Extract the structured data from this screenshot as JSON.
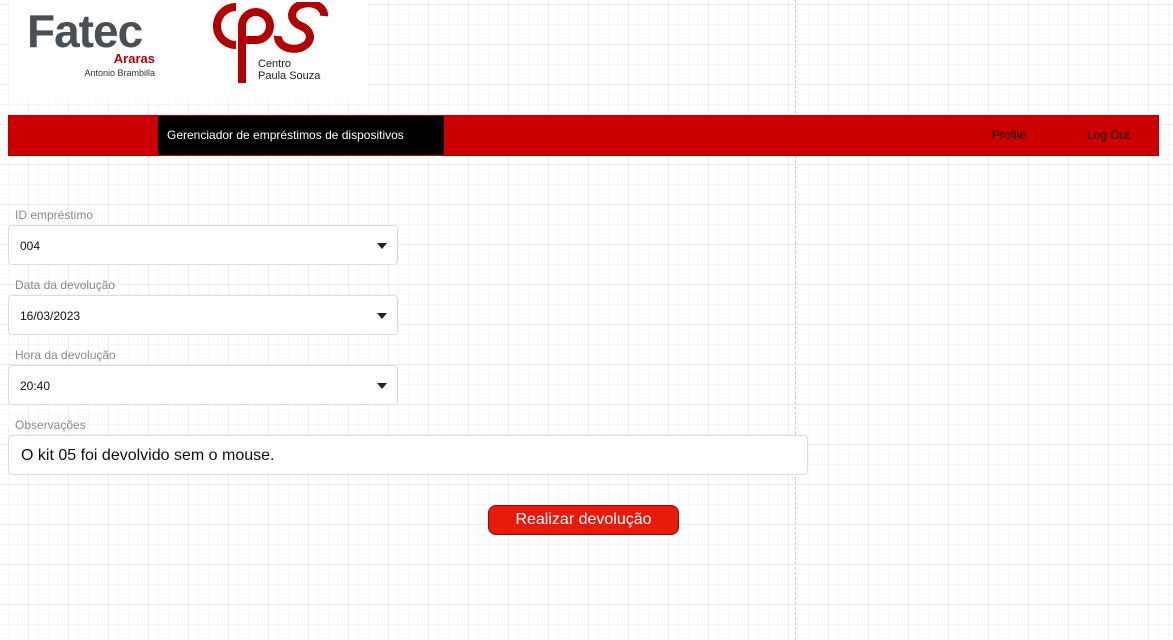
{
  "logos": {
    "fatec": {
      "name": "Fatec",
      "city": "Araras",
      "unit": "Antonio Brambilla"
    },
    "cps": {
      "line1": "Centro",
      "line2": "Paula Souza"
    }
  },
  "navbar": {
    "title": "Gerenciador de empréstimos de dispositivos",
    "profile_label": "Profile",
    "logout_label": "Log Out"
  },
  "form": {
    "loan_id": {
      "label": "ID empréstimo",
      "value": "004"
    },
    "return_date": {
      "label": "Data da devolução",
      "value": "16/03/2023"
    },
    "return_time": {
      "label": "Hora da devolução",
      "value": "20:40"
    },
    "notes": {
      "label": "Observações",
      "value": "O kit 05 foi devolvido sem o mouse."
    },
    "submit_label": "Realizar devolução"
  },
  "colors": {
    "navbar": "#cc0000",
    "nav_title_bg": "#000000",
    "button": "#e81a0c",
    "fatec_gray": "#4a4f54",
    "brand_red": "#c00000"
  }
}
